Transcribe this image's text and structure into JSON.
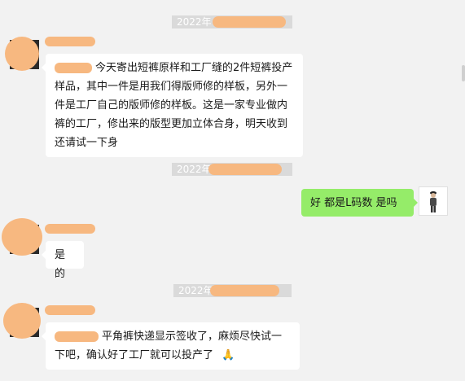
{
  "messages": {
    "timestamp_1": "2022年",
    "timestamp_2": "2022年",
    "timestamp_3": "2022年",
    "msg1_text": "今天寄出短裤原样和工厂缝的2件短裤投产样品，其中一件是用我们得版师修的样板，另外一件是工厂自己的版师修的样板。这是一家专业做内裤的工厂，修出来的版型更加立体合身，明天收到还请试一下身",
    "msg2_text": "好 都是L码数 是吗",
    "msg3_text": "是的",
    "msg4_text": "平角裤快递显示签收了，麻烦尽快试一下吧，确认好了工厂就可以投产了",
    "msg4_emoji": "🙏"
  },
  "colors": {
    "background": "#f2f2f2",
    "incoming_bubble": "#ffffff",
    "outgoing_bubble": "#95ec69",
    "redaction": "#f7b880"
  }
}
